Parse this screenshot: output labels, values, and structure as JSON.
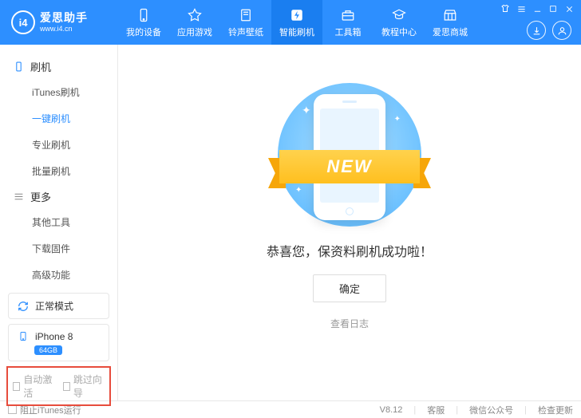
{
  "logo": {
    "badge": "i4",
    "title": "爱思助手",
    "url": "www.i4.cn"
  },
  "nav": [
    {
      "icon": "device",
      "label": "我的设备"
    },
    {
      "icon": "apps",
      "label": "应用游戏"
    },
    {
      "icon": "ringtone",
      "label": "铃声壁纸"
    },
    {
      "icon": "flash",
      "label": "智能刷机"
    },
    {
      "icon": "toolbox",
      "label": "工具箱"
    },
    {
      "icon": "tutorial",
      "label": "教程中心"
    },
    {
      "icon": "store",
      "label": "爱思商城"
    }
  ],
  "sidebar": {
    "groups": [
      {
        "icon": "flash",
        "title": "刷机",
        "items": [
          "iTunes刷机",
          "一键刷机",
          "专业刷机",
          "批量刷机"
        ],
        "selected": 1
      },
      {
        "icon": "more",
        "title": "更多",
        "items": [
          "其他工具",
          "下载固件",
          "高级功能"
        ],
        "selected": -1
      }
    ],
    "mode": {
      "icon": "refresh",
      "label": "正常模式"
    },
    "device": {
      "icon": "phone",
      "name": "iPhone 8",
      "storage": "64GB"
    },
    "bottomChecks": [
      "自动激活",
      "跳过向导"
    ]
  },
  "main": {
    "ribbon": "NEW",
    "success": "恭喜您，保资料刷机成功啦！",
    "ok": "确定",
    "log": "查看日志"
  },
  "footer": {
    "block": "阻止iTunes运行",
    "version": "V8.12",
    "links": [
      "客服",
      "微信公众号",
      "检查更新"
    ]
  }
}
